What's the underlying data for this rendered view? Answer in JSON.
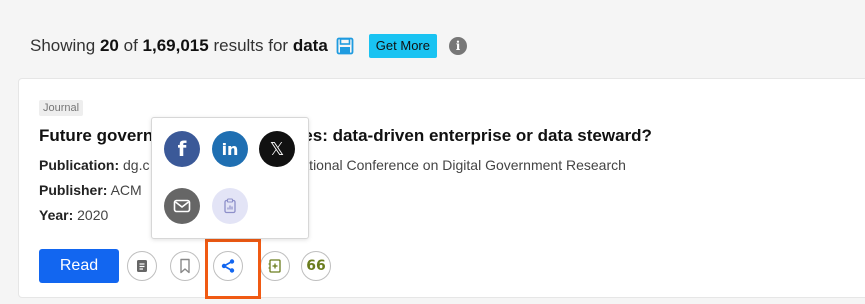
{
  "results": {
    "showing": "Showing",
    "count": "20",
    "of": "of",
    "total": "1,69,015",
    "results_for": "results for",
    "query": "data",
    "get_more": "Get More",
    "info": "i"
  },
  "card": {
    "tag": "Journal",
    "title_start": "Future govern",
    "title_end": "es: data-driven enterprise or data steward?",
    "publication_label": "Publication:",
    "publication_value_start": "dg.c",
    "publication_value_end": "nternational Conference on Digital Government Research",
    "publisher_label": "Publisher:",
    "publisher_value": "ACM",
    "year_label": "Year:",
    "year_value": "2020",
    "read_label": "Read",
    "cite_label": "66"
  },
  "share_popup": {
    "facebook": "f",
    "linkedin": "in",
    "x": "𝕏"
  },
  "colors": {
    "accent_blue": "#1266f0",
    "get_more_bg": "#19c3f2",
    "facebook": "#3b5998",
    "linkedin": "#1f6fb2",
    "x": "#111111",
    "email": "#666666",
    "highlight": "#f05a13"
  }
}
